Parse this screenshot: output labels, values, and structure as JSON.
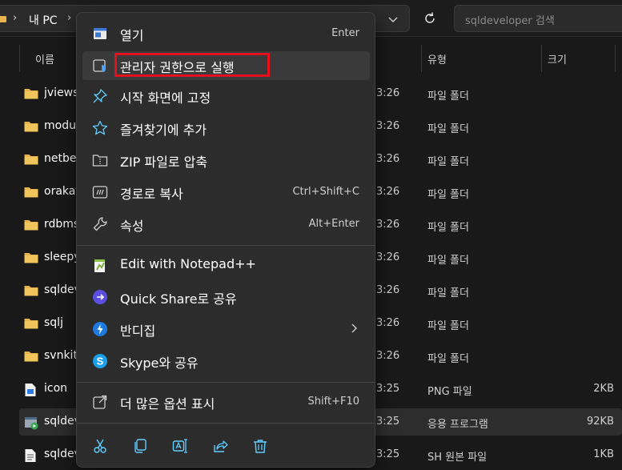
{
  "explorer": {
    "breadcrumb": {
      "sep": "›",
      "location": "내 PC",
      "sep2": "›"
    },
    "search": {
      "placeholder": "sqldeveloper 검색"
    },
    "columns": {
      "name": "이름",
      "type": "유형",
      "size": "크기"
    },
    "rows": [
      {
        "name": "jviews",
        "date": "3:26",
        "type": "파일 폴더",
        "size": "",
        "icon": "folder-icon"
      },
      {
        "name": "modules",
        "date": "3:26",
        "type": "파일 폴더",
        "size": "",
        "icon": "folder-icon"
      },
      {
        "name": "netbeans",
        "date": "3:26",
        "type": "파일 폴더",
        "size": "",
        "icon": "folder-icon"
      },
      {
        "name": "orakafka",
        "date": "3:26",
        "type": "파일 폴더",
        "size": "",
        "icon": "folder-icon"
      },
      {
        "name": "rdbms",
        "date": "3:26",
        "type": "파일 폴더",
        "size": "",
        "icon": "folder-icon"
      },
      {
        "name": "sleepycat",
        "date": "3:26",
        "type": "파일 폴더",
        "size": "",
        "icon": "folder-icon"
      },
      {
        "name": "sqldeveloper",
        "date": "3:26",
        "type": "파일 폴더",
        "size": "",
        "icon": "folder-icon"
      },
      {
        "name": "sqlj",
        "date": "3:26",
        "type": "파일 폴더",
        "size": "",
        "icon": "folder-icon"
      },
      {
        "name": "svnkit",
        "date": "3:26",
        "type": "파일 폴더",
        "size": "",
        "icon": "folder-icon"
      },
      {
        "name": "icon",
        "date": "3:25",
        "type": "PNG 파일",
        "size": "2KB",
        "icon": "image-file-icon"
      },
      {
        "name": "sqldeveloper",
        "date": "3:25",
        "type": "응용 프로그램",
        "size": "92KB",
        "icon": "app-icon"
      },
      {
        "name": "sqldeveloper",
        "date": "3:25",
        "type": "SH 원본 파일",
        "size": "1KB",
        "icon": "text-file-icon"
      }
    ]
  },
  "menu": {
    "items": [
      {
        "label": "열기",
        "shortcut": "Enter",
        "icon": "open-window-icon"
      },
      {
        "label": "관리자 권한으로 실행",
        "shortcut": "",
        "icon": "shield-admin-icon",
        "highlighted": true
      },
      {
        "label": "시작 화면에 고정",
        "shortcut": "",
        "icon": "pin-icon"
      },
      {
        "label": "즐겨찾기에 추가",
        "shortcut": "",
        "icon": "star-icon"
      },
      {
        "label": "ZIP 파일로 압축",
        "shortcut": "",
        "icon": "zip-icon"
      },
      {
        "label": "경로로 복사",
        "shortcut": "Ctrl+Shift+C",
        "icon": "copy-path-icon"
      },
      {
        "label": "속성",
        "shortcut": "Alt+Enter",
        "icon": "wrench-icon"
      },
      {
        "label": "Edit with Notepad++",
        "shortcut": "",
        "icon": "notepadpp-icon"
      },
      {
        "label": "Quick Share로 공유",
        "shortcut": "",
        "icon": "quick-share-icon"
      },
      {
        "label": "반디집",
        "shortcut": "",
        "icon": "bandizip-icon",
        "submenu": true
      },
      {
        "label": "Skype와 공유",
        "shortcut": "",
        "icon": "skype-icon"
      },
      {
        "label": "더 많은 옵션 표시",
        "shortcut": "Shift+F10",
        "icon": "more-options-icon"
      }
    ],
    "quick_actions": [
      "cut-icon",
      "copy-icon",
      "rename-icon",
      "share-icon",
      "delete-icon"
    ]
  },
  "colors": {
    "menu_bg": "#2c2c2c",
    "highlight_border": "#e3101f",
    "folder": "#e8b34a",
    "accent": "#60cdff"
  }
}
